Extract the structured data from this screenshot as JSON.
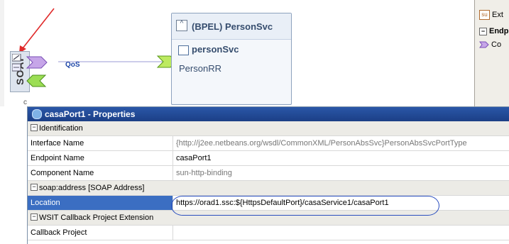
{
  "canvas": {
    "soap_label": "SOAP",
    "qos_label": "QoS",
    "partial_label": "c",
    "bpel": {
      "collapse_symbol": "^",
      "title": "(BPEL) PersonSvc",
      "service_name": "personSvc",
      "port_name": "PersonRR"
    }
  },
  "palette": {
    "items": [
      {
        "icon": "su",
        "label": "Ext"
      },
      {
        "icon": "minus",
        "label": "Endp"
      },
      {
        "icon": "arrow",
        "label": "Co"
      }
    ]
  },
  "properties": {
    "title": "casaPort1 - Properties",
    "categories": {
      "identification": "Identification",
      "soap_address": "soap:address [SOAP Address]",
      "wsit": "WSIT Callback Project Extension"
    },
    "rows": {
      "interface_name": {
        "key": "Interface Name",
        "value": "{http://j2ee.netbeans.org/wsdl/CommonXML/PersonAbsSvc}PersonAbsSvcPortType"
      },
      "endpoint_name": {
        "key": "Endpoint Name",
        "value": "casaPort1"
      },
      "component_name": {
        "key": "Component Name",
        "value": "sun-http-binding"
      },
      "location": {
        "key": "Location",
        "value": "https://orad1.ssc:${HttpsDefaultPort}/casaService1/casaPort1"
      },
      "callback_project": {
        "key": "Callback Project",
        "value": ""
      }
    }
  },
  "colors": {
    "accent_title": "#1c3f86",
    "selection": "#3b6ec2",
    "annotation_arrow": "#e02a2a",
    "annotation_oval": "#2b4fbf"
  }
}
